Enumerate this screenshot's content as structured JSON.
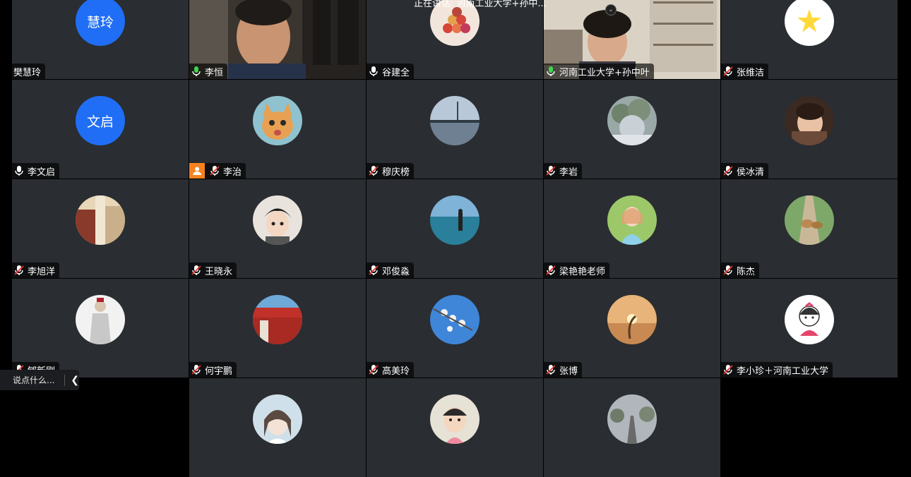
{
  "speaking": "正在讲话: 河南工业大学+孙中...",
  "chat": {
    "placeholder": "说点什么..."
  },
  "tiles": [
    {
      "name": "樊慧玲",
      "avatar_text": "慧玲",
      "mic": "none"
    },
    {
      "name": "李恒",
      "mic": "on",
      "video": true
    },
    {
      "name": "谷建全",
      "mic": "unmuted-white"
    },
    {
      "name": "河南工业大学+孙中叶",
      "mic": "on",
      "video": true,
      "active": true
    },
    {
      "name": "张维洁",
      "mic": "muted"
    },
    {
      "name": "李文启",
      "avatar_text": "文启",
      "mic": "unmuted-white"
    },
    {
      "name": "李治",
      "mic": "muted",
      "person_badge": true
    },
    {
      "name": "穆庆榜",
      "mic": "muted"
    },
    {
      "name": "李岩",
      "mic": "muted"
    },
    {
      "name": "侯冰清",
      "mic": "muted"
    },
    {
      "name": "李旭洋",
      "mic": "muted"
    },
    {
      "name": "王晓永",
      "mic": "muted"
    },
    {
      "name": "邓俊淼",
      "mic": "muted"
    },
    {
      "name": "梁艳艳老师",
      "mic": "muted"
    },
    {
      "name": "陈杰",
      "mic": "muted"
    },
    {
      "name": "郇新刚",
      "mic": "muted"
    },
    {
      "name": "何宇鹏",
      "mic": "muted"
    },
    {
      "name": "高美玲",
      "mic": "muted"
    },
    {
      "name": "张博",
      "mic": "muted"
    },
    {
      "name": "李小珍＋河南工业大学",
      "mic": "muted"
    }
  ]
}
